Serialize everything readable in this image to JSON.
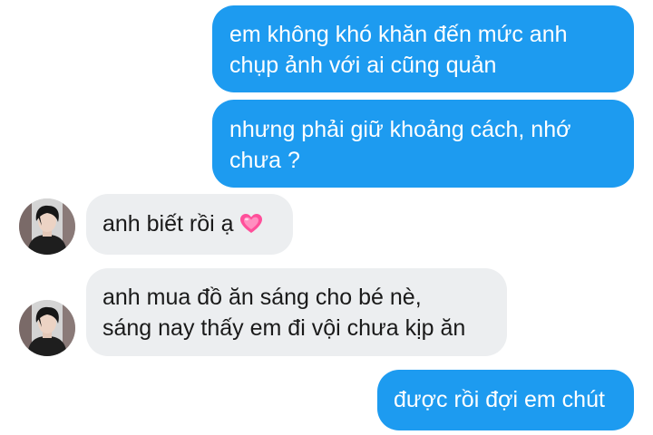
{
  "conversation": {
    "messages": [
      {
        "direction": "outgoing",
        "lines": [
          "em không khó khăn đến mức anh",
          "chụp ảnh với ai cũng quản"
        ]
      },
      {
        "direction": "outgoing",
        "lines": [
          "nhưng phải giữ khoảng cách, nhớ",
          "chưa ?"
        ]
      },
      {
        "direction": "incoming",
        "lines": [
          "anh biết rồi ạ"
        ],
        "emoji": "growing-heart-icon"
      },
      {
        "direction": "incoming",
        "lines": [
          "anh mua đồ ăn sáng cho bé nè,",
          "sáng nay thấy em đi vội chưa kịp ăn"
        ]
      },
      {
        "direction": "outgoing",
        "lines": [
          "được rồi đợi em chút"
        ]
      }
    ]
  },
  "colors": {
    "outgoing_bubble": "#1d9bf0",
    "incoming_bubble": "#eceef0",
    "outgoing_text": "#ffffff",
    "incoming_text": "#1a1a1a"
  }
}
